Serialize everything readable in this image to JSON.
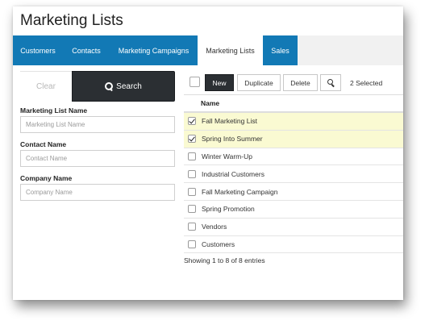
{
  "page": {
    "title": "Marketing Lists"
  },
  "tabs": [
    {
      "label": "Customers",
      "active": false
    },
    {
      "label": "Contacts",
      "active": false
    },
    {
      "label": "Marketing Campaigns",
      "active": false
    },
    {
      "label": "Marketing Lists",
      "active": true
    },
    {
      "label": "Sales",
      "active": false
    }
  ],
  "colors": {
    "tab_blue": "#1279b5",
    "dark_button": "#2b2f33",
    "selected_row": "#fafad2"
  },
  "search_panel": {
    "clear_label": "Clear",
    "search_label": "Search",
    "search_icon": "search-icon",
    "fields": [
      {
        "label": "Marketing List Name",
        "placeholder": "Marketing List Name",
        "value": ""
      },
      {
        "label": "Contact Name",
        "placeholder": "Contact Name",
        "value": ""
      },
      {
        "label": "Company Name",
        "placeholder": "Company Name",
        "value": ""
      }
    ]
  },
  "toolbar": {
    "new_label": "New",
    "duplicate_label": "Duplicate",
    "delete_label": "Delete",
    "search_icon": "search-icon",
    "selected_text": "2 Selected"
  },
  "table": {
    "column_header": "Name",
    "rows": [
      {
        "name": "Fall Marketing List",
        "checked": true
      },
      {
        "name": "Spring Into Summer",
        "checked": true
      },
      {
        "name": "Winter Warm-Up",
        "checked": false
      },
      {
        "name": "Industrial Customers",
        "checked": false
      },
      {
        "name": "Fall Marketing Campaign",
        "checked": false
      },
      {
        "name": "Spring Promotion",
        "checked": false
      },
      {
        "name": "Vendors",
        "checked": false
      },
      {
        "name": "Customers",
        "checked": false
      }
    ],
    "footer": "Showing 1 to 8 of 8 entries"
  }
}
